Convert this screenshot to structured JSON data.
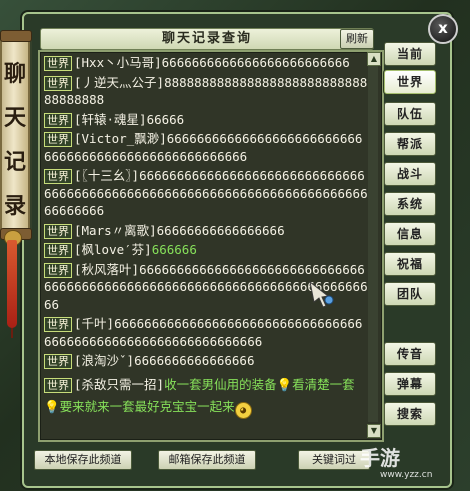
{
  "panel": {
    "title": "聊天记录查询",
    "refresh_label": "刷新",
    "close_label": "x",
    "emblem_chars": [
      "聊",
      "天",
      "记",
      "录"
    ]
  },
  "tabs": [
    "当前",
    "世界",
    "队伍",
    "帮派",
    "战斗",
    "系统",
    "信息",
    "祝福",
    "团队",
    "传音",
    "弹幕",
    "搜索"
  ],
  "active_tab": "世界",
  "messages": [
    {
      "channel": "世界",
      "sender": "[Hxx丶小马哥]",
      "text": "6666666666666666666666666"
    },
    {
      "channel": "世界",
      "sender": "[丿逆天灬公子]",
      "text": "88888888888888888888888888888888888"
    },
    {
      "channel": "世界",
      "sender": "[轩辕·魂星]",
      "text": "66666"
    },
    {
      "channel": "世界",
      "sender": "[Victor_飘渺]",
      "text": "66666666666666666666666666666666666666666666666666666"
    },
    {
      "channel": "世界",
      "sender": "[〖十三幺〗]",
      "text": "666666666666666666666666666666666666666666666666666666666666666666666666666666666"
    },
    {
      "channel": "世界",
      "sender": "[Mars〃离歌]",
      "text": "66666666666666666"
    },
    {
      "channel": "世界",
      "sender": "[枫love′芬]",
      "text": "666666",
      "text_color": "green"
    },
    {
      "channel": "世界",
      "sender": "[秋风落叶]",
      "text": "666666666666666666666666666666666666666666666666666666666666666666666666666"
    },
    {
      "channel": "世界",
      "sender": "[千叶]",
      "text": "66666666666666666666666666666666666666666666666666666666666666"
    },
    {
      "channel": "世界",
      "sender": "[浪淘沙ˇ]",
      "text": "6666666666666666"
    }
  ],
  "special_message": {
    "channel": "世界",
    "sender": "[杀敌只需一招]",
    "part1": "收一套男仙用的装备",
    "part2": "看清楚一套",
    "part3": "要来就来一套最好克宝宝一起来"
  },
  "bottom": {
    "save_local": "本地保存此频道",
    "save_mail": "邮箱保存此频道",
    "keyword": "关键词过"
  },
  "watermark": {
    "logo": "手游",
    "url": "www.yzz.cn"
  },
  "colors": {
    "green_text": "#86e05a",
    "yellow_text": "#e9f24a",
    "channel_border": "#c7dc7a"
  }
}
